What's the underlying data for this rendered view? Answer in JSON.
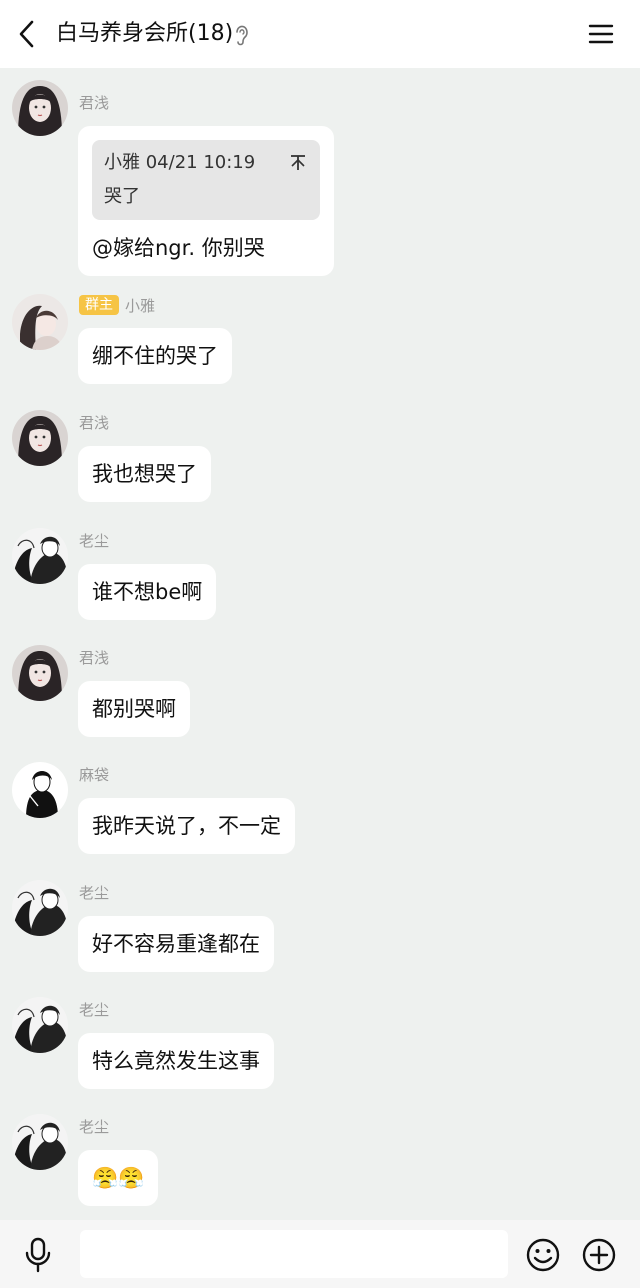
{
  "header": {
    "title": "白马养身会所(18)",
    "back_icon": "chevron-left-icon",
    "ear_icon": "ear-icon",
    "menu_icon": "hamburger-menu-icon"
  },
  "messages": [
    {
      "sender": "君浅",
      "avatar": "avatar-junqian",
      "quote": {
        "author_time": "小雅 04/21 10:19",
        "text": "哭了"
      },
      "text": "@嫁给ngr. 你别哭"
    },
    {
      "sender": "小雅",
      "badge": "群主",
      "avatar": "avatar-xiaoya",
      "text": "绷不住的哭了"
    },
    {
      "sender": "君浅",
      "avatar": "avatar-junqian",
      "text": "我也想哭了"
    },
    {
      "sender": "老尘",
      "avatar": "avatar-laochen",
      "text": "谁不想be啊"
    },
    {
      "sender": "君浅",
      "avatar": "avatar-junqian",
      "text": "都别哭啊"
    },
    {
      "sender": "麻袋",
      "avatar": "avatar-madai",
      "text": "我昨天说了，不一定"
    },
    {
      "sender": "老尘",
      "avatar": "avatar-laochen",
      "text": "好不容易重逢都在"
    },
    {
      "sender": "老尘",
      "avatar": "avatar-laochen",
      "text": "特么竟然发生这事"
    },
    {
      "sender": "老尘",
      "avatar": "avatar-laochen",
      "text": "😤😤"
    }
  ],
  "input_bar": {
    "mic_icon": "microphone-icon",
    "input_value": "",
    "emoji_icon": "smiley-icon",
    "plus_icon": "plus-circle-icon"
  },
  "colors": {
    "background": "#eef1ef",
    "bubble": "#ffffff",
    "badge": "#f6c445",
    "nickname": "#9a9a9a"
  }
}
